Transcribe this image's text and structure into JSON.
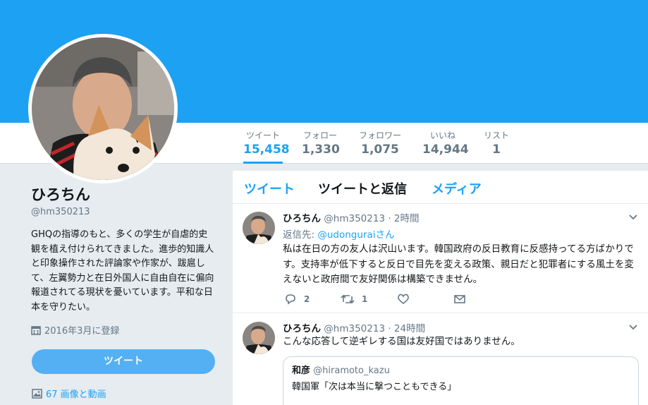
{
  "profile_nav": {
    "stats": [
      {
        "label": "ツイート",
        "value": "15,458"
      },
      {
        "label": "フォロー",
        "value": "1,330"
      },
      {
        "label": "フォロワー",
        "value": "1,075"
      },
      {
        "label": "いいね",
        "value": "14,944"
      },
      {
        "label": "リスト",
        "value": "1"
      }
    ]
  },
  "profile": {
    "name": "ひろちん",
    "handle": "@hm350213",
    "bio": "GHQの指導のもと、多くの学生が自虐的史観を植え付けられてきました。進歩的知識人と印象操作された評論家や作家が、跋扈して、左翼勢力と在日外国人に自由自在に偏向報道されてる現状を憂いています。平和な日本を守りたい。",
    "joined": "2016年3月に登録",
    "tweet_button": "ツイート",
    "media_link": "67 画像と動画"
  },
  "timeline": {
    "tabs": [
      "ツイート",
      "ツイートと返信",
      "メディア"
    ],
    "tweets": [
      {
        "name": "ひろちん",
        "handle": "@hm350213",
        "time": "· 2時間",
        "reply_prefix": "返信先: ",
        "reply_to": "@udonguraiさん",
        "text": "私は在日の方の友人は沢山います。韓国政府の反日教育に反感持ってる方ばかりです。支持率が低下すると反日で目先を変える政策、親日だと犯罪者にする風土を変えないと政府間で友好関係は構築できません。",
        "replies": "2",
        "retweets": "1"
      },
      {
        "name": "ひろちん",
        "handle": "@hm350213",
        "time": "· 24時間",
        "text": "こんな応答して逆ギレする国は友好国ではありません。",
        "quote": {
          "name": "和彦",
          "handle": "@hiramoto_kazu",
          "text": "韓国軍「次は本当に撃つこともできる」"
        }
      }
    ]
  },
  "colors": {
    "accent": "#1da1f2",
    "banner": "#1da1f2",
    "background": "#e6ecf0"
  },
  "icons": [
    "calendar-icon",
    "image-icon",
    "reply-icon",
    "retweet-icon",
    "like-icon",
    "message-icon",
    "chevron-down-icon"
  ]
}
